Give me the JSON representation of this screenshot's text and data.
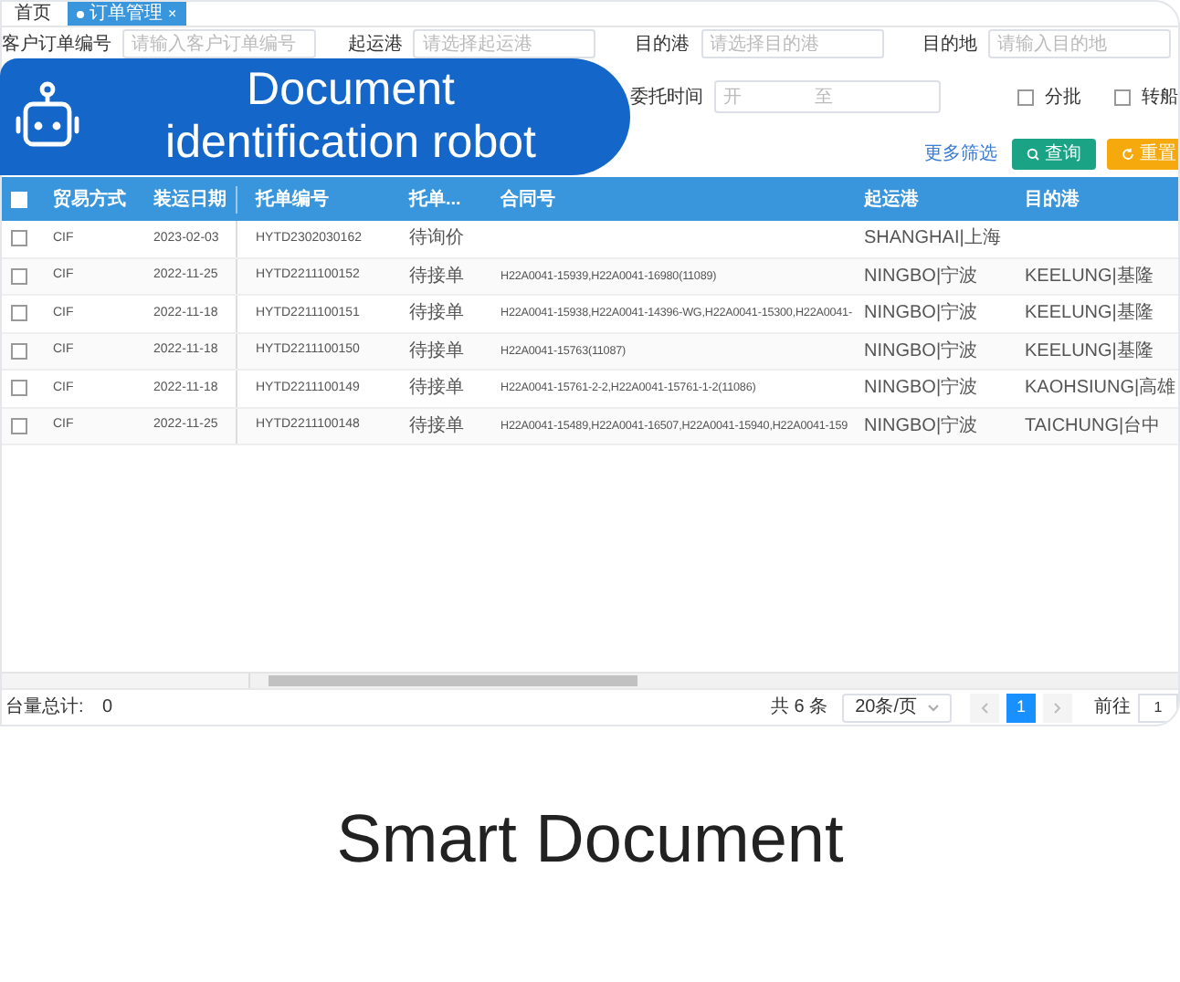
{
  "tabs": [
    {
      "label": "首页",
      "selected": false
    },
    {
      "label": "订单管理",
      "selected": true,
      "close": "×"
    }
  ],
  "filters": {
    "row1": [
      {
        "label": "客户订单编号",
        "placeholder": "请输入客户订单编号"
      },
      {
        "label": "起运港",
        "placeholder": "请选择起运港"
      },
      {
        "label": "目的港",
        "placeholder": "请选择目的港"
      },
      {
        "label": "目的地",
        "placeholder": "请输入目的地"
      }
    ],
    "date": {
      "label": "委托时间",
      "start": "开",
      "separator": "至"
    },
    "checks": [
      {
        "label": "分批",
        "checked": false
      },
      {
        "label": "转船",
        "checked": false
      }
    ],
    "more": "更多筛选",
    "search": "查询",
    "reset": "重置"
  },
  "badge": {
    "title": "Document identification robot"
  },
  "table": {
    "header_checked": false,
    "columns": [
      "贸易方式",
      "装运日期",
      "托单编号",
      "托单...",
      "合同号",
      "起运港",
      "目的港"
    ],
    "rows": [
      {
        "checked": false,
        "cells": [
          "CIF",
          "2023-02-03",
          "HYTD2302030162",
          "待询价",
          "",
          "SHANGHAI|上海",
          ""
        ]
      },
      {
        "checked": false,
        "cells": [
          "CIF",
          "2022-11-25",
          "HYTD2211100152",
          "待接单",
          "H22A0041-15939,H22A0041-16980(11089)",
          "NINGBO|宁波",
          "KEELUNG|基隆"
        ]
      },
      {
        "checked": false,
        "cells": [
          "CIF",
          "2022-11-18",
          "HYTD2211100151",
          "待接单",
          "H22A0041-15938,H22A0041-14396-WG,H22A0041-15300,H22A0041-",
          "NINGBO|宁波",
          "KEELUNG|基隆"
        ]
      },
      {
        "checked": false,
        "cells": [
          "CIF",
          "2022-11-18",
          "HYTD2211100150",
          "待接单",
          "H22A0041-15763(11087)",
          "NINGBO|宁波",
          "KEELUNG|基隆"
        ]
      },
      {
        "checked": false,
        "cells": [
          "CIF",
          "2022-11-18",
          "HYTD2211100149",
          "待接单",
          "H22A0041-15761-2-2,H22A0041-15761-1-2(11086)",
          "NINGBO|宁波",
          "KAOHSIUNG|高雄"
        ]
      },
      {
        "checked": false,
        "cells": [
          "CIF",
          "2022-11-25",
          "HYTD2211100148",
          "待接单",
          "H22A0041-15489,H22A0041-16507,H22A0041-15940,H22A0041-159",
          "NINGBO|宁波",
          "TAICHUNG|台中"
        ]
      }
    ]
  },
  "footer": {
    "total_label": "台量总计:",
    "total": "0",
    "count": "共 6 条",
    "page_size": "20条/页",
    "pages": [
      {
        "label": "1",
        "selected": true
      }
    ],
    "goto_label": "前往",
    "goto": "1"
  },
  "caption": "Smart Document"
}
